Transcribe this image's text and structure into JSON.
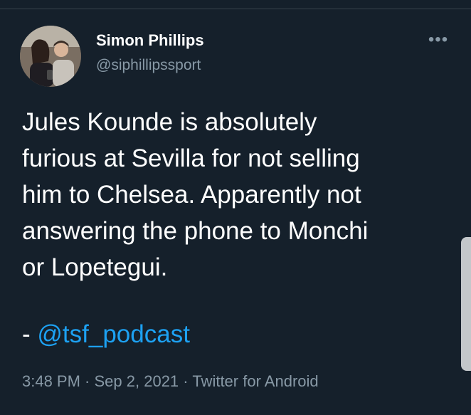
{
  "tweet": {
    "author_name": "Simon Phillips",
    "author_handle": "@siphillipssport",
    "more_label": "•••",
    "text_lines": [
      "Jules Kounde is absolutely",
      "furious at Sevilla for not selling",
      "him to Chelsea. Apparently not",
      "answering the phone to Monchi",
      "or Lopetegui."
    ],
    "attribution_prefix": "- ",
    "attribution_mention": "@tsf_podcast",
    "time": "3:48 PM",
    "date": "Sep 2, 2021",
    "source": "Twitter for Android",
    "separator": " · "
  },
  "colors": {
    "background": "#15202b",
    "text": "#ffffff",
    "secondary": "#8899a6",
    "link": "#1da1f2"
  },
  "icons": {
    "more": "more-options-icon",
    "avatar": "profile-avatar"
  }
}
